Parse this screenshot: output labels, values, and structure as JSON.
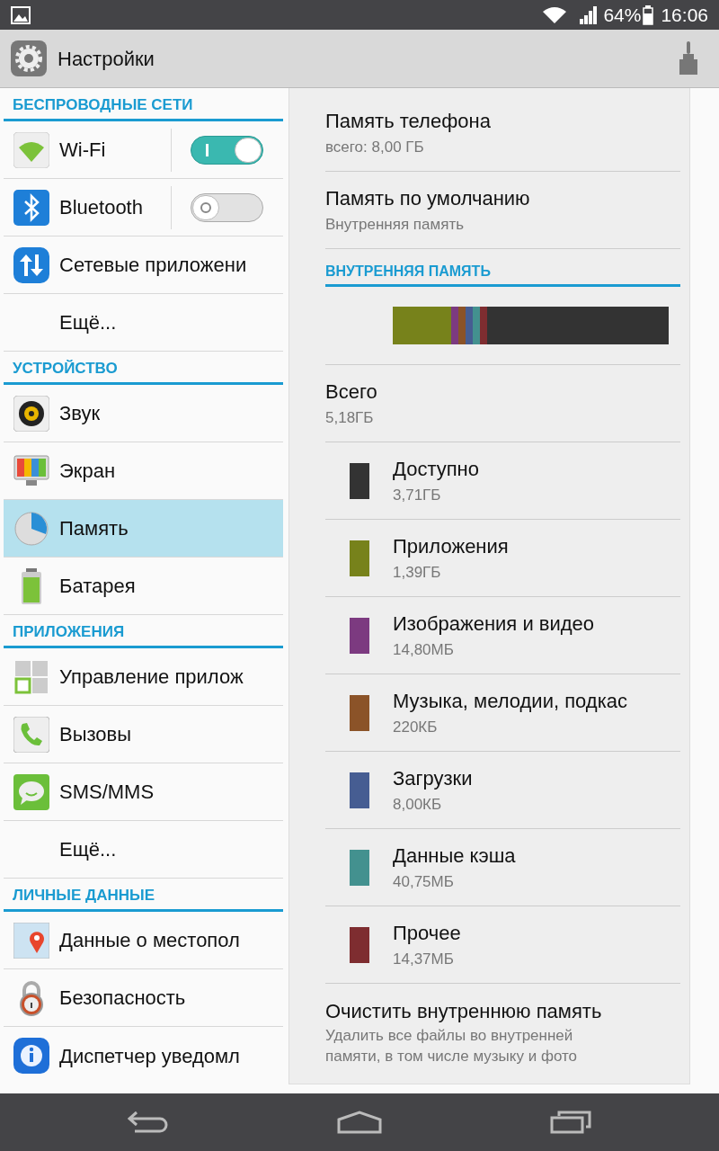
{
  "status_bar": {
    "battery": "64%",
    "time": "16:06"
  },
  "action_bar": {
    "title": "Настройки"
  },
  "sidebar": {
    "sections": [
      {
        "header": "БЕСПРОВОДНЫЕ СЕТИ",
        "items": [
          {
            "label": "Wi-Fi",
            "kind": "toggle",
            "on": true,
            "selected": false
          },
          {
            "label": "Bluetooth",
            "kind": "toggle",
            "on": false,
            "selected": false
          },
          {
            "label": "Сетевые приложени",
            "kind": "plain",
            "selected": false
          },
          {
            "label": "Ещё...",
            "kind": "plain",
            "selected": false
          }
        ]
      },
      {
        "header": "УСТРОЙСТВО",
        "items": [
          {
            "label": "Звук",
            "kind": "plain",
            "selected": false
          },
          {
            "label": "Экран",
            "kind": "plain",
            "selected": false
          },
          {
            "label": "Память",
            "kind": "plain",
            "selected": true
          },
          {
            "label": "Батарея",
            "kind": "plain",
            "selected": false
          }
        ]
      },
      {
        "header": "ПРИЛОЖЕНИЯ",
        "items": [
          {
            "label": "Управление прилож",
            "kind": "plain",
            "selected": false
          },
          {
            "label": "Вызовы",
            "kind": "plain",
            "selected": false
          },
          {
            "label": "SMS/MMS",
            "kind": "plain",
            "selected": false
          },
          {
            "label": "Ещё...",
            "kind": "plain",
            "selected": false
          }
        ]
      },
      {
        "header": "ЛИЧНЫЕ ДАННЫЕ",
        "items": [
          {
            "label": "Данные о местопол",
            "kind": "plain",
            "selected": false
          },
          {
            "label": "Безопасность",
            "kind": "plain",
            "selected": false
          },
          {
            "label": "Диспетчер уведомл",
            "kind": "plain",
            "selected": false
          }
        ]
      }
    ]
  },
  "storage": {
    "phone": [
      {
        "title": "Память телефона",
        "subtitle": "всего: 8,00 ГБ"
      },
      {
        "title": "Память по умолчанию",
        "subtitle": "Внутренняя память"
      }
    ],
    "section_header": "ВНУТРЕННЯЯ ПАМЯТЬ",
    "total": {
      "title": "Всего",
      "value": "5,18ГБ"
    },
    "categories": [
      {
        "name": "Доступно",
        "size": "3,71ГБ",
        "color": "#333333",
        "kind": "free"
      },
      {
        "name": "Приложения",
        "size": "1,39ГБ",
        "color": "#77821b",
        "kind": "used"
      },
      {
        "name": "Изображения и видео",
        "size": "14,80МБ",
        "color": "#7c3a80",
        "kind": "used"
      },
      {
        "name": "Музыка, мелодии, подкас",
        "size": "220КБ",
        "color": "#8b5328",
        "kind": "used"
      },
      {
        "name": "Загрузки",
        "size": "8,00КБ",
        "color": "#465d92",
        "kind": "used"
      },
      {
        "name": "Данные кэша",
        "size": "40,75МБ",
        "color": "#43918f",
        "kind": "used"
      },
      {
        "name": "Прочее",
        "size": "14,37МБ",
        "color": "#7e2d30",
        "kind": "used"
      }
    ],
    "clear": {
      "title": "Очистить внутреннюю память",
      "subtitle": "Удалить все файлы во внутренней памяти, в том числе музыку и фото"
    }
  }
}
